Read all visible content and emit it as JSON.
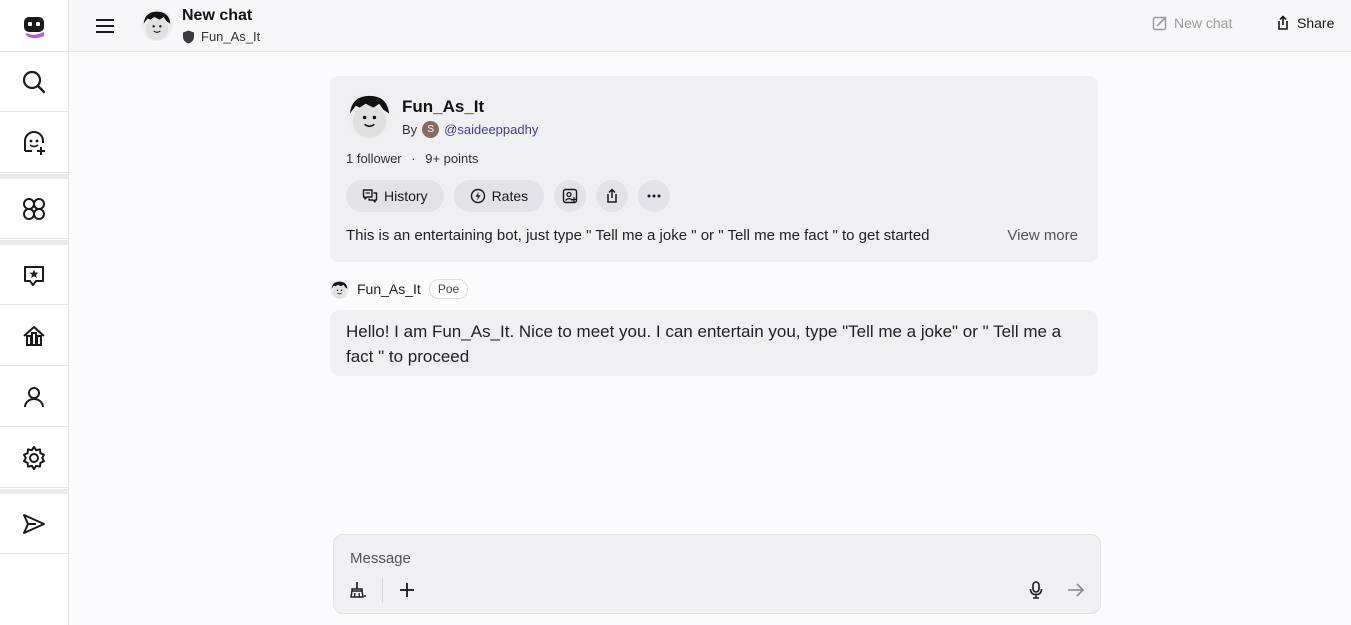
{
  "sidebar": {
    "items": [
      {
        "name": "poe-logo-icon"
      },
      {
        "name": "search-icon"
      },
      {
        "name": "create-bot-icon"
      },
      {
        "name": "explore-bots-icon"
      },
      {
        "name": "bot-chat-icon"
      },
      {
        "name": "creator-hub-icon"
      },
      {
        "name": "profile-icon"
      },
      {
        "name": "settings-icon"
      },
      {
        "name": "send-feedback-icon"
      }
    ]
  },
  "header": {
    "title": "New chat",
    "bot_name": "Fun_As_It",
    "new_chat_label": "New chat",
    "share_label": "Share"
  },
  "bot_card": {
    "name": "Fun_As_It",
    "by_label": "By",
    "creator_initial": "S",
    "creator_handle": "@saideeppadhy",
    "followers": "1 follower",
    "separator": "·",
    "points": "9+ points",
    "history_label": "History",
    "rates_label": "Rates",
    "description": "This is an entertaining bot, just type \" Tell me a joke \" or \" Tell me me fact \" to get started",
    "view_more_label": "View more"
  },
  "message": {
    "sender": "Fun_As_It",
    "badge": "Poe",
    "text": "Hello! I am Fun_As_It. Nice to meet you. I can entertain you, type \"Tell me a joke\" or \" Tell me a fact \" to proceed"
  },
  "composer": {
    "placeholder": "Message"
  },
  "colors": {
    "accent": "#3f3d9e",
    "card_bg": "#f0f0f3",
    "page_bg": "#fbfbfd"
  }
}
